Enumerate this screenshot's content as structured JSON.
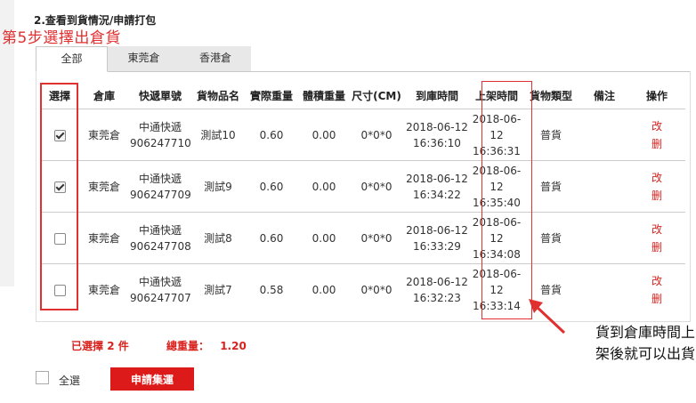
{
  "section_title": "2.查看到貨情況/申請打包",
  "annotations": {
    "step": "第5步選擇出倉貨",
    "note_line1": "貨到倉庫時間上",
    "note_line2": "架後就可以出貨"
  },
  "tabs": [
    {
      "label": "全部",
      "active": true
    },
    {
      "label": "東莞倉",
      "active": false
    },
    {
      "label": "香港倉",
      "active": false
    }
  ],
  "table": {
    "headers": [
      "選擇",
      "倉庫",
      "快遞單號",
      "貨物品名",
      "實際重量",
      "體積重量",
      "尺寸(CM)",
      "到庫時間",
      "上架時間",
      "貨物類型",
      "備注",
      "操作"
    ],
    "rows": [
      {
        "checked": true,
        "warehouse": "東莞倉",
        "courier": "中通快遞",
        "tracking": "906247710",
        "name": "測試10",
        "actual_weight": "0.60",
        "vol_weight": "0.00",
        "size": "0*0*0",
        "arrive_date": "2018-06-12",
        "arrive_time": "16:36:10",
        "shelf_date": "2018-06-12",
        "shelf_time": "16:36:31",
        "type": "普貨",
        "remark": "",
        "op1": "改",
        "op2": "删"
      },
      {
        "checked": true,
        "warehouse": "東莞倉",
        "courier": "中通快遞",
        "tracking": "906247709",
        "name": "測試9",
        "actual_weight": "0.60",
        "vol_weight": "0.00",
        "size": "0*0*0",
        "arrive_date": "2018-06-12",
        "arrive_time": "16:34:22",
        "shelf_date": "2018-06-12",
        "shelf_time": "16:35:40",
        "type": "普貨",
        "remark": "",
        "op1": "改",
        "op2": "删"
      },
      {
        "checked": false,
        "warehouse": "東莞倉",
        "courier": "中通快遞",
        "tracking": "906247708",
        "name": "測試8",
        "actual_weight": "0.60",
        "vol_weight": "0.00",
        "size": "0*0*0",
        "arrive_date": "2018-06-12",
        "arrive_time": "16:33:29",
        "shelf_date": "2018-06-12",
        "shelf_time": "16:34:08",
        "type": "普貨",
        "remark": "",
        "op1": "改",
        "op2": "删"
      },
      {
        "checked": false,
        "warehouse": "東莞倉",
        "courier": "中通快遞",
        "tracking": "906247707",
        "name": "測試7",
        "actual_weight": "0.58",
        "vol_weight": "0.00",
        "size": "0*0*0",
        "arrive_date": "2018-06-12",
        "arrive_time": "16:32:23",
        "shelf_date": "2018-06-12",
        "shelf_time": "16:33:14",
        "type": "普貨",
        "remark": "",
        "op1": "改",
        "op2": "删"
      }
    ]
  },
  "summary": {
    "selected_label": "已選擇",
    "selected_count": "2",
    "selected_unit": "件",
    "total_label": "總重量：",
    "total_value": "1.20"
  },
  "footer": {
    "select_all_label": "全選",
    "apply_button": "申請集運"
  },
  "colors": {
    "accent_red": "#dd1a1a",
    "annotation_red": "#e03030"
  }
}
